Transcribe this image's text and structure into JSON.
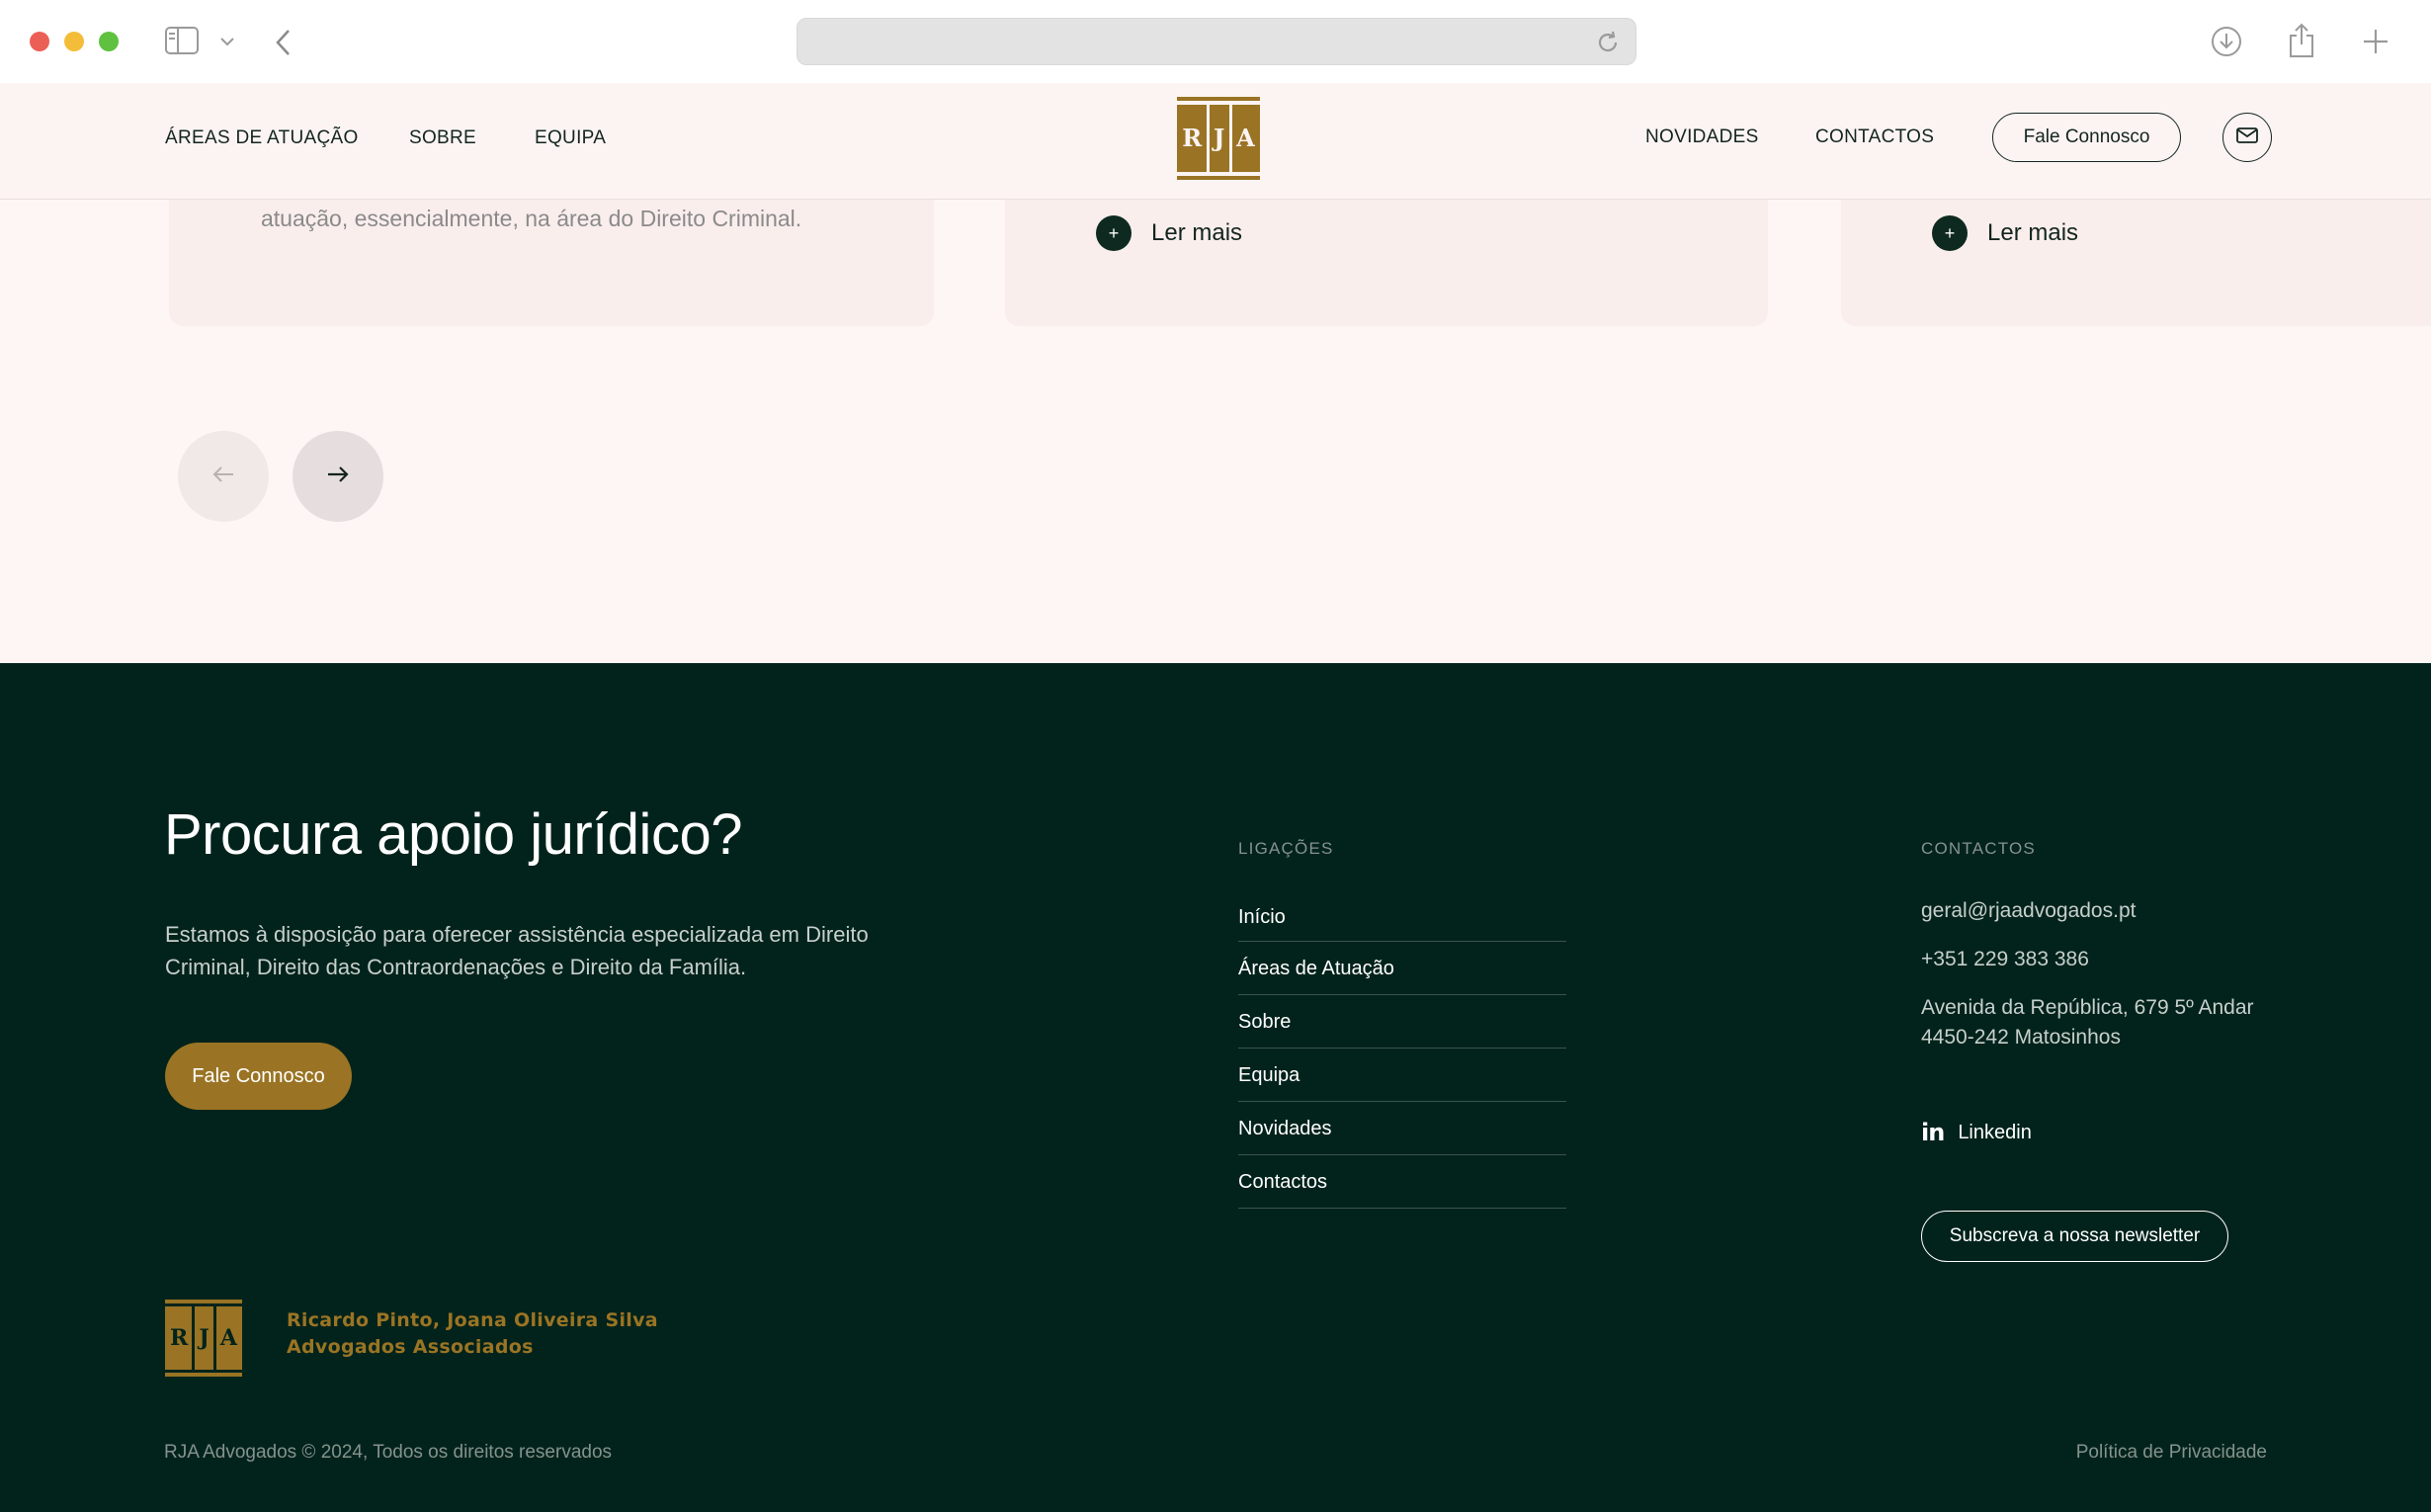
{
  "nav": {
    "left_links": [
      "ÁREAS DE ATUAÇÃO",
      "SOBRE",
      "EQUIPA"
    ],
    "right_links": [
      "NOVIDADES",
      "CONTACTOS"
    ],
    "cta": "Fale Connosco",
    "logo_letters": [
      "R",
      "J",
      "A"
    ]
  },
  "cards": {
    "text": "atuação, essencialmente, na área do Direito Criminal.",
    "read_more": "Ler mais"
  },
  "footer": {
    "title": "Procura apoio jurídico?",
    "description": "Estamos à disposição para oferecer assistência especializada em Direito Criminal, Direito das Contraordenações e Direito da Família.",
    "cta": "Fale Connosco",
    "links_heading": "LIGAÇÕES",
    "links": [
      "Início",
      "Áreas de Atuação",
      "Sobre",
      "Equipa",
      "Novidades",
      "Contactos"
    ],
    "contacts_heading": "CONTACTOS",
    "email": "geral@rjaadvogados.pt",
    "phone": "+351 229 383 386",
    "address_line1": "Avenida da República, 679 5º Andar",
    "address_line2": "4450-242 Matosinhos",
    "linkedin": "Linkedin",
    "newsletter": "Subscreva a nossa newsletter",
    "firm_line1": "Ricardo Pinto, Joana Oliveira Silva",
    "firm_line2": "Advogados Associados",
    "copyright": "RJA Advogados © 2024, Todos os direitos reservados",
    "privacy": "Política de Privacidade"
  },
  "colors": {
    "brand_gold": "#9a7424",
    "footer_bg": "#02231b",
    "page_bg": "#fdf6f5"
  }
}
